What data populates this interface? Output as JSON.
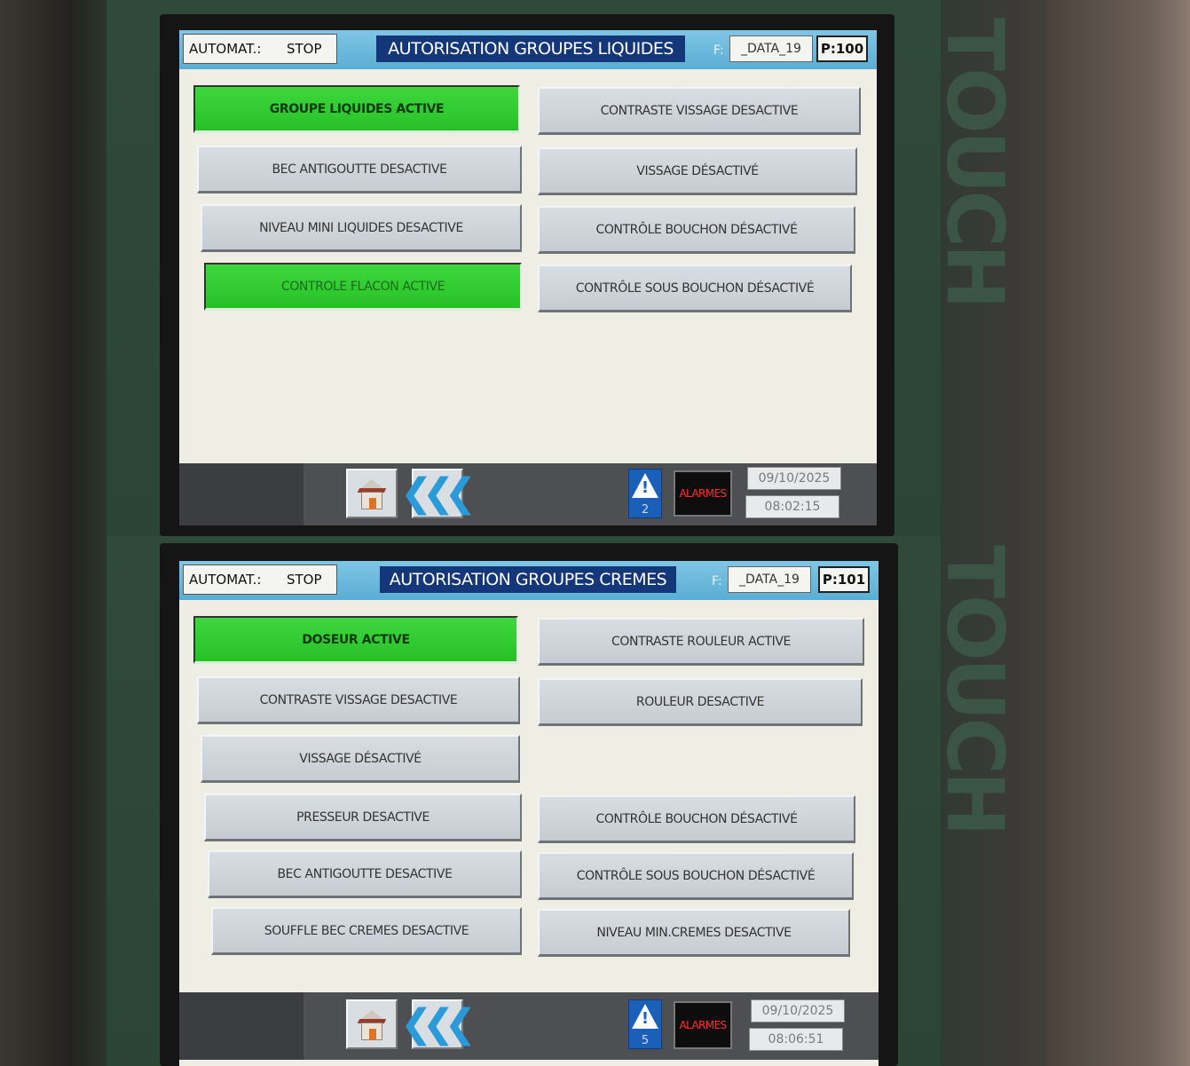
{
  "panels": [
    {
      "automat_label": "AUTOMAT.:",
      "automat_value": "STOP",
      "title": "AUTORISATION GROUPES LIQUIDES",
      "f_label": "F:",
      "data_id": "_DATA_19",
      "page": "P:100",
      "left_buttons": [
        {
          "label": "GROUPE LIQUIDES ACTIVE",
          "state": "active"
        },
        {
          "label": "BEC ANTIGOUTTE DESACTIVE",
          "state": "inactive"
        },
        {
          "label": "NIVEAU MINI LIQUIDES DESACTIVE",
          "state": "inactive"
        },
        {
          "label": "CONTROLE FLACON ACTIVE",
          "state": "active"
        }
      ],
      "right_buttons": [
        {
          "label": "CONTRASTE VISSAGE DESACTIVE",
          "state": "inactive"
        },
        {
          "label": "VISSAGE DÉSACTIVÉ",
          "state": "inactive"
        },
        {
          "label": "CONTRÔLE BOUCHON DÉSACTIVÉ",
          "state": "inactive"
        },
        {
          "label": "CONTRÔLE SOUS BOUCHON DÉSACTIVÉ",
          "state": "inactive"
        }
      ],
      "footer": {
        "home_icon": "home-icon",
        "back_icon": "double-chevron-left-icon",
        "warning_icon": "warning-triangle-icon",
        "warning_count": "2",
        "alarms_label": "ALARMES",
        "date": "09/10/2025",
        "time": "08:02:15"
      }
    },
    {
      "automat_label": "AUTOMAT.:",
      "automat_value": "STOP",
      "title": "AUTORISATION GROUPES CREMES",
      "f_label": "F:",
      "data_id": "_DATA_19",
      "page": "P:101",
      "left_buttons": [
        {
          "label": "DOSEUR ACTIVE",
          "state": "active"
        },
        {
          "label": "CONTRASTE VISSAGE DESACTIVE",
          "state": "inactive"
        },
        {
          "label": "VISSAGE DÉSACTIVÉ",
          "state": "inactive"
        },
        {
          "label": "PRESSEUR DESACTIVE",
          "state": "inactive"
        },
        {
          "label": "BEC ANTIGOUTTE DESACTIVE",
          "state": "inactive"
        },
        {
          "label": "SOUFFLE BEC CREMES DESACTIVE",
          "state": "inactive"
        }
      ],
      "right_buttons": [
        {
          "label": "CONTRASTE ROULEUR ACTIVE",
          "state": "inactive"
        },
        {
          "label": "ROULEUR DESACTIVE",
          "state": "inactive"
        },
        {
          "label": "CONTRÔLE BOUCHON DÉSACTIVÉ",
          "state": "inactive"
        },
        {
          "label": "CONTRÔLE SOUS BOUCHON DÉSACTIVÉ",
          "state": "inactive"
        },
        {
          "label": "NIVEAU MIN.CREMES DESACTIVE",
          "state": "inactive"
        }
      ],
      "footer": {
        "home_icon": "home-icon",
        "back_icon": "double-chevron-left-icon",
        "warning_icon": "warning-triangle-icon",
        "warning_count": "5",
        "alarms_label": "ALARMES",
        "date": "09/10/2025",
        "time": "08:06:51"
      }
    }
  ],
  "colors": {
    "active_green": "#2ecc2e",
    "inactive_gray": "#cfd4d9",
    "header_blue": "#5aaed3",
    "title_navy": "#14377a",
    "alarm_red": "#ff2b2b"
  }
}
